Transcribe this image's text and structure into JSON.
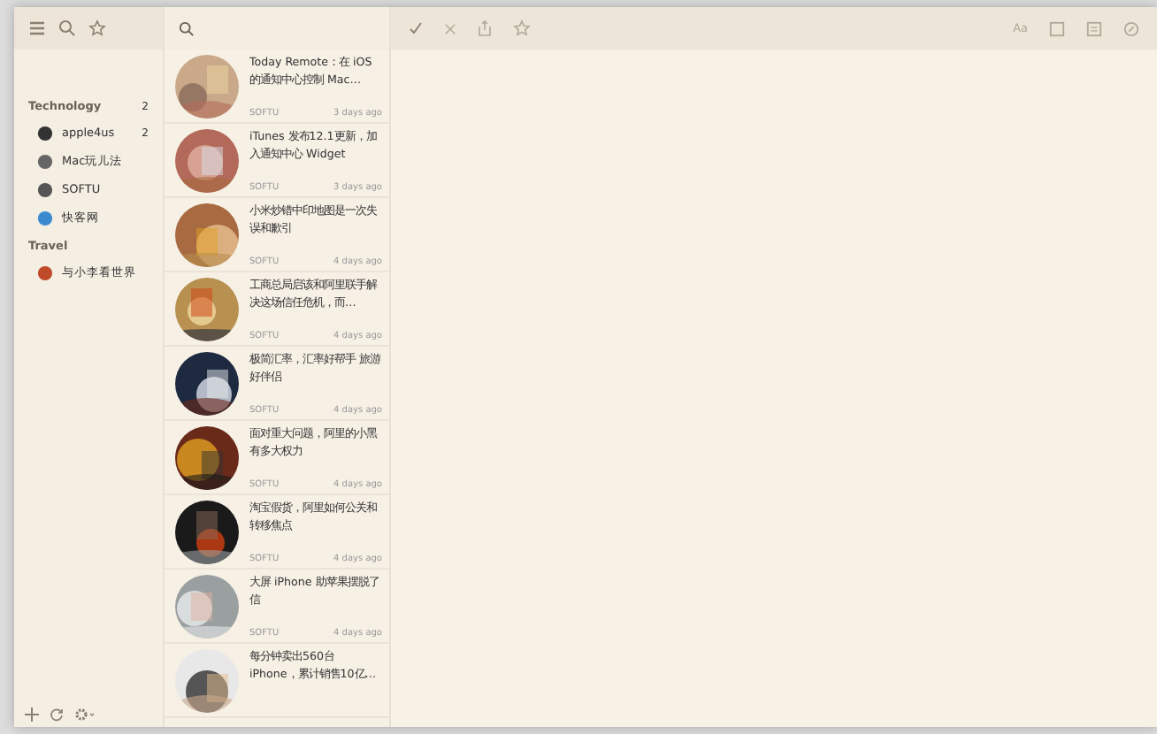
{
  "sidebar": {
    "sections": [
      {
        "title": "Technology",
        "count": "2",
        "feeds": [
          {
            "name": "apple4us",
            "count": "2"
          },
          {
            "name": "Mac玩儿法"
          },
          {
            "name": "SOFTU"
          },
          {
            "name": "快客网"
          }
        ]
      },
      {
        "title": "Travel",
        "feeds": [
          {
            "name": "与小李看世界"
          }
        ]
      }
    ]
  },
  "articles": [
    {
      "title": "Today Remote：在 iOS 的通知中心控制 Mac…",
      "source": "SOFTU",
      "time": "3 days ago"
    },
    {
      "title": "iTunes 发布12.1更新，加入通知中心 Widget",
      "source": "SOFTU",
      "time": "3 days ago"
    },
    {
      "title": "小米炒错中印地图是一次失误和歉引",
      "source": "SOFTU",
      "time": "4 days ago"
    },
    {
      "title": "工商总局启该和阿里联手解决这场信任危机，而…",
      "source": "SOFTU",
      "time": "4 days ago"
    },
    {
      "title": "极简汇率，汇率好帮手 旅游好伴侣",
      "source": "SOFTU",
      "time": "4 days ago"
    },
    {
      "title": "面对重大问题，阿里的小黑有多大权力",
      "source": "SOFTU",
      "time": "4 days ago"
    },
    {
      "title": "淘宝假货，阿里如何公关和转移焦点",
      "source": "SOFTU",
      "time": "4 days ago"
    },
    {
      "title": "大屏 iPhone 助苹果摆脱了信",
      "source": "SOFTU",
      "time": "4 days ago"
    },
    {
      "title": "每分钟卖出560台 iPhone，累计销售10亿…"
    }
  ],
  "toolbar": {
    "font_button": "Aa"
  }
}
